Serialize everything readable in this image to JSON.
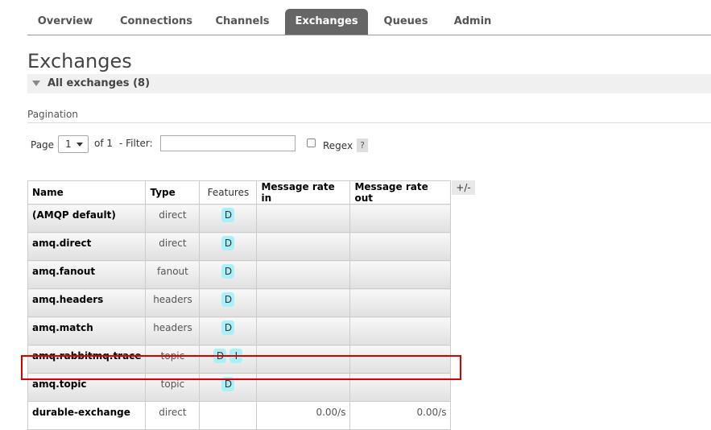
{
  "nav": {
    "tabs": [
      {
        "label": "Overview"
      },
      {
        "label": "Connections"
      },
      {
        "label": "Channels"
      },
      {
        "label": "Exchanges",
        "active": true
      },
      {
        "label": "Queues"
      },
      {
        "label": "Admin"
      }
    ]
  },
  "page": {
    "title": "Exchanges",
    "section_title": "All exchanges (8)",
    "pagination_label": "Pagination"
  },
  "pagination": {
    "page_label": "Page",
    "page_value": "1",
    "of_label": "of 1",
    "filter_label": "- Filter:",
    "filter_value": "",
    "regex_label": "Regex",
    "regex_checked": false,
    "help_label": "?"
  },
  "table": {
    "headers": {
      "name": "Name",
      "type": "Type",
      "features": "Features",
      "rate_in": "Message rate in",
      "rate_out": "Message rate out"
    },
    "toggle_label": "+/-",
    "rows": [
      {
        "name": "(AMQP default)",
        "type": "direct",
        "badges": [
          "D"
        ],
        "rate_in": "",
        "rate_out": ""
      },
      {
        "name": "amq.direct",
        "type": "direct",
        "badges": [
          "D"
        ],
        "rate_in": "",
        "rate_out": ""
      },
      {
        "name": "amq.fanout",
        "type": "fanout",
        "badges": [
          "D"
        ],
        "rate_in": "",
        "rate_out": ""
      },
      {
        "name": "amq.headers",
        "type": "headers",
        "badges": [
          "D"
        ],
        "rate_in": "",
        "rate_out": ""
      },
      {
        "name": "amq.match",
        "type": "headers",
        "badges": [
          "D"
        ],
        "rate_in": "",
        "rate_out": ""
      },
      {
        "name": "amq.rabbitmq.trace",
        "type": "topic",
        "badges": [
          "D",
          "I"
        ],
        "rate_in": "",
        "rate_out": ""
      },
      {
        "name": "amq.topic",
        "type": "topic",
        "badges": [
          "D"
        ],
        "rate_in": "",
        "rate_out": ""
      },
      {
        "name": "durable-exchange",
        "type": "direct",
        "badges": [],
        "rate_in": "0.00/s",
        "rate_out": "0.00/s"
      }
    ]
  },
  "colors": {
    "active_tab": "#666666",
    "badge": "#aaf0f8",
    "highlight": "#d90000"
  }
}
